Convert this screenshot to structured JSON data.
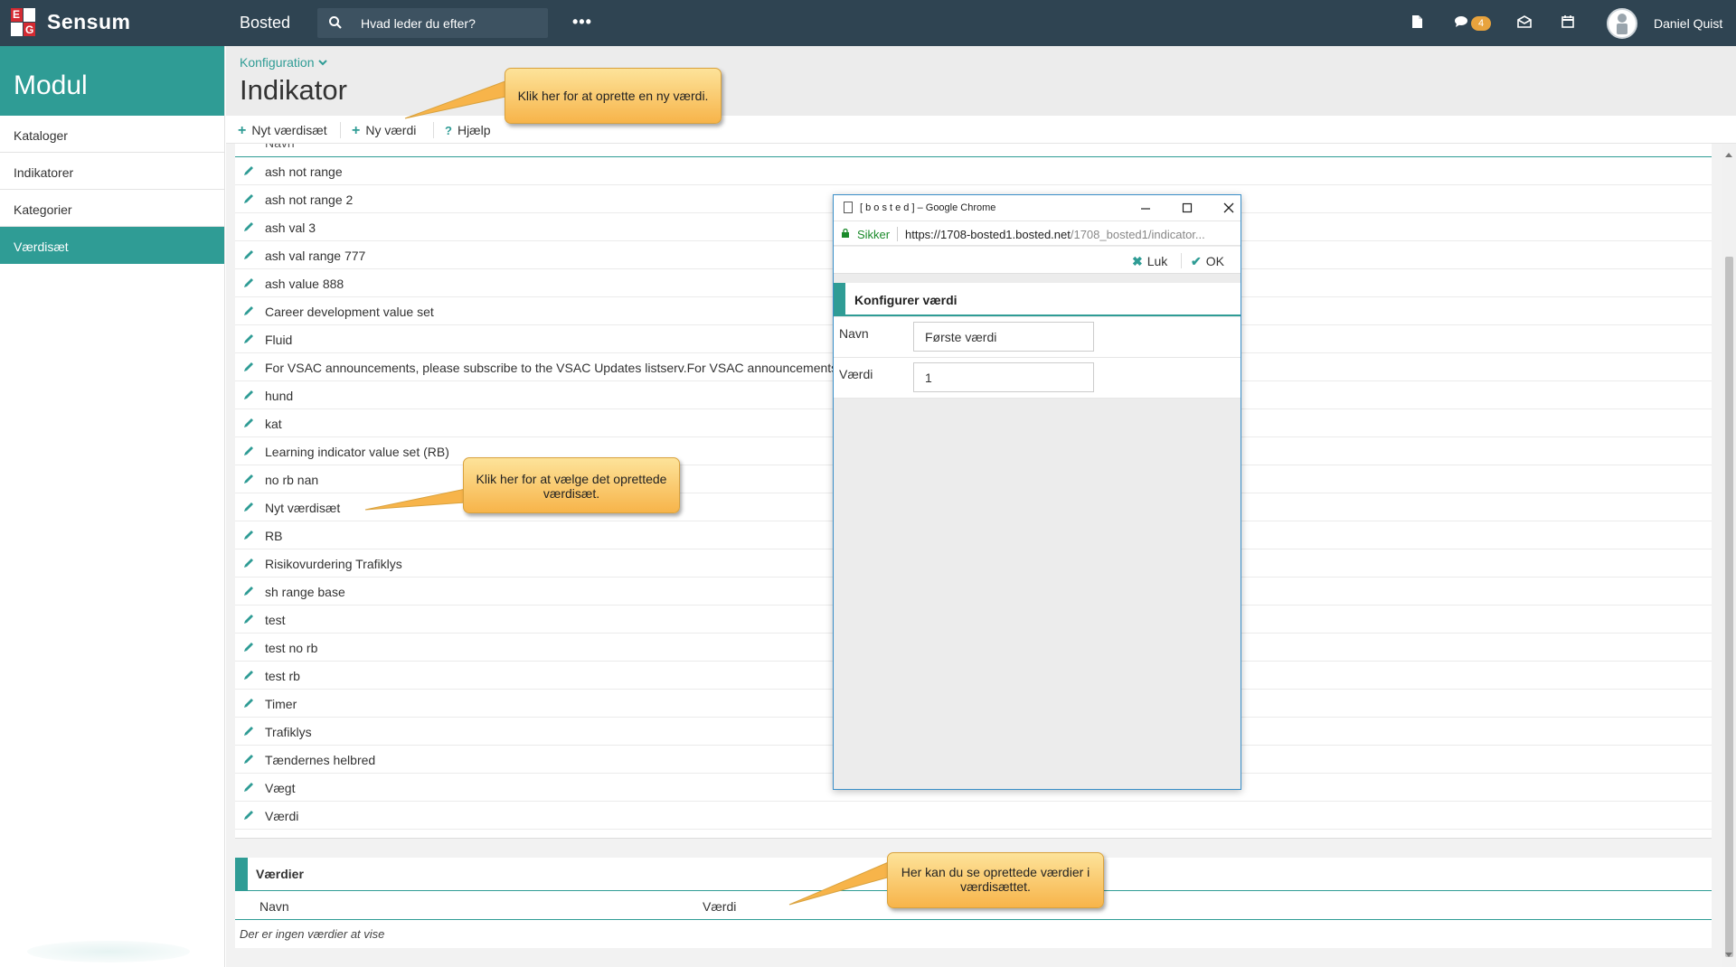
{
  "topbar": {
    "logo_text": "Sensum",
    "logo_letters": [
      "E",
      "G"
    ],
    "app_name": "Bosted",
    "search_placeholder": "Hvad leder du efter?",
    "more_label": "•••",
    "messages_badge": "4",
    "username": "Daniel Quist",
    "icons": [
      "document-icon",
      "chat-icon",
      "mail-icon",
      "calendar-icon"
    ]
  },
  "sidebar": {
    "heading": "Modul",
    "items": [
      {
        "label": "Kataloger",
        "active": false
      },
      {
        "label": "Indikatorer",
        "active": false
      },
      {
        "label": "Kategorier",
        "active": false
      },
      {
        "label": "Værdisæt",
        "active": true
      }
    ]
  },
  "header": {
    "breadcrumb": "Konfiguration",
    "title": "Indikator"
  },
  "toolbar": {
    "new_set_label": "Nyt værdisæt",
    "new_value_label": "Ny værdi",
    "help_label": "Hjælp"
  },
  "list": {
    "column_header": "Navn",
    "rows": [
      "ash not range",
      "ash not range 2",
      "ash val 3",
      "ash val range 777",
      "ash value 888",
      "Career development value set",
      "Fluid",
      "For VSAC announcements, please subscribe to the VSAC Updates listserv.For VSAC announcements",
      "hund",
      "kat",
      "Learning indicator value set (RB)",
      "no rb nan",
      "Nyt værdisæt",
      "RB",
      "Risikovurdering Trafiklys",
      "sh range base",
      "test",
      "test no rb",
      "test rb",
      "Timer",
      "Trafiklys",
      "Tændernes helbred",
      "Vægt",
      "Værdi"
    ]
  },
  "values_panel": {
    "title": "Værdier",
    "col_name": "Navn",
    "col_value": "Værdi",
    "empty_text": "Der er ingen værdier at vise"
  },
  "popup": {
    "window_title": "[ b o s t e d ] – Google Chrome",
    "secure_label": "Sikker",
    "url_main": "https://1708-bosted1.bosted.net",
    "url_rest": "/1708_bosted1/indicator...",
    "close_label": "Luk",
    "ok_label": "OK",
    "section_title": "Konfigurer værdi",
    "name_label": "Navn",
    "name_value": "Første værdi",
    "value_label": "Værdi",
    "value_value": "1"
  },
  "callouts": {
    "new_value": "Klik her for at oprette en ny værdi.",
    "select_set": "Klik her for at vælge det oprettede værdisæt.",
    "see_values": "Her kan du se oprettede værdier i værdisættet."
  },
  "colors": {
    "topbar": "#2f4452",
    "accent": "#2f9c95",
    "badge": "#e8a33d",
    "callout": "#f7b44a",
    "popup_border": "#3a8fc9"
  }
}
